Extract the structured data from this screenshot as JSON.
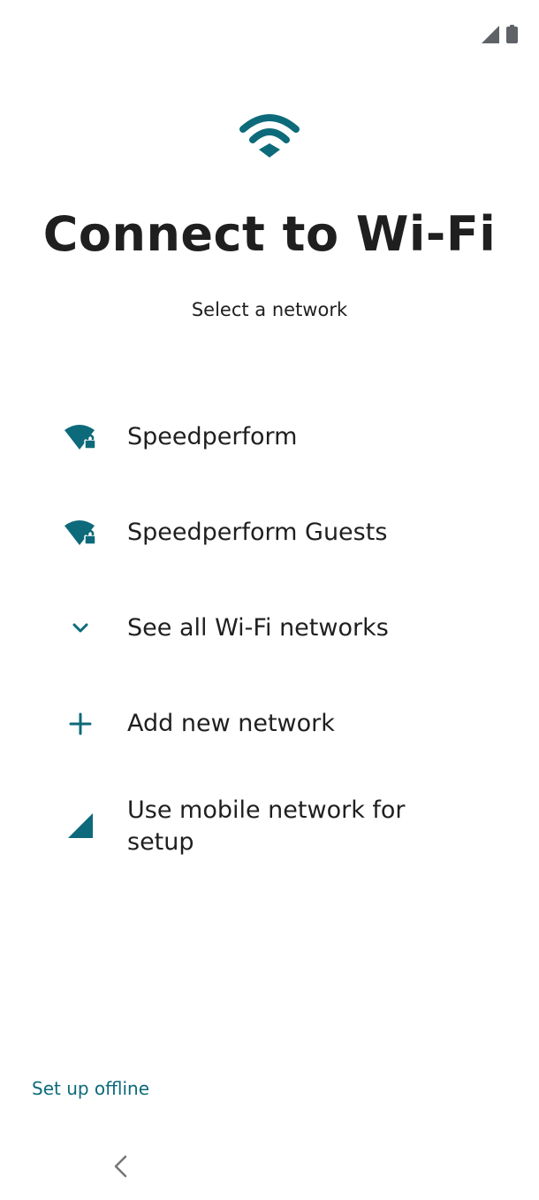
{
  "status_bar": {
    "icons": [
      "cellular-signal-icon",
      "battery-icon"
    ]
  },
  "header": {
    "icon": "wifi-icon",
    "title": "Connect to Wi-Fi",
    "subtitle": "Select a network"
  },
  "networks": [
    {
      "label": "Speedperform",
      "icon": "wifi-lock-icon"
    },
    {
      "label": "Speedperform Guests",
      "icon": "wifi-lock-icon"
    }
  ],
  "actions": {
    "see_all": {
      "label": "See all Wi-Fi networks",
      "icon": "chevron-down-icon"
    },
    "add_network": {
      "label": "Add new network",
      "icon": "plus-icon"
    },
    "mobile_network": {
      "label": "Use mobile network for setup",
      "icon": "cellular-signal-icon"
    }
  },
  "footer": {
    "offline_label": "Set up offline"
  },
  "colors": {
    "accent": "#0d6a7a",
    "text": "#1f1f1f",
    "background": "#ffffff",
    "status_icon": "#5f6368",
    "nav_icon": "#757575"
  }
}
